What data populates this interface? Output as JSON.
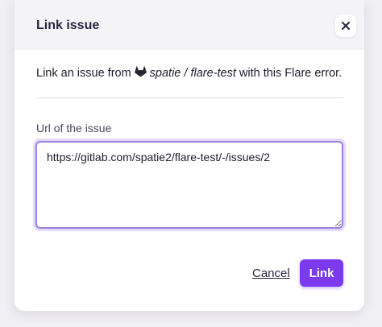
{
  "dialog": {
    "title": "Link issue",
    "close_icon": "close-icon"
  },
  "description": {
    "prefix": "Link an issue from",
    "provider_icon": "gitlab-icon",
    "repository": "spatie / flare-test",
    "suffix": "with this Flare error."
  },
  "issue_url": {
    "label": "Url of the issue",
    "value": "https://gitlab.com/spatie2/flare-test/-/issues/2"
  },
  "actions": {
    "cancel_label": "Cancel",
    "link_label": "Link"
  },
  "colors": {
    "primary": "#7c3aed",
    "focus_border": "#9d7fe0",
    "gitlab_icon": "#1f1c2c"
  }
}
